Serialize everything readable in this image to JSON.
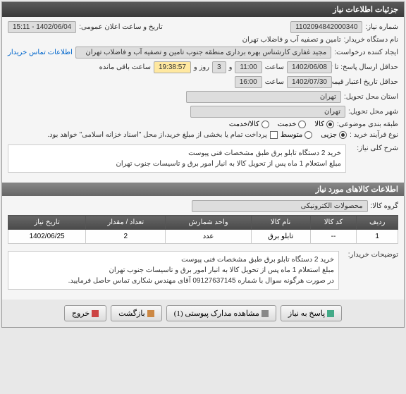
{
  "header": {
    "title": "جزئیات اطلاعات نیاز"
  },
  "fields": {
    "need_number_label": "شماره نیاز:",
    "need_number": "1102094842000340",
    "announce_label": "تاریخ و ساعت اعلان عمومی:",
    "announce_value": "1402/06/04 - 15:11",
    "buyer_org_label": "نام دستگاه خریدار:",
    "buyer_org": "تامین و تصفیه آب و فاضلاب تهران",
    "creator_label": "ایجاد کننده درخواست:",
    "creator": "مجید غفاری کارشناس بهره برداری منطقه جنوب تامین و تصفیه آب و فاضلاب تهران",
    "contact_link": "اطلاعات تماس خریدار",
    "deadline_label": "حداقل ارسال پاسخ: تا تاریخ:",
    "deadline_date": "1402/06/08",
    "time_label": "ساعت",
    "deadline_time": "11:00",
    "and_label": "و",
    "days_value": "3",
    "days_label": "روز و",
    "countdown": "19:38:57",
    "remaining_label": "ساعت باقی مانده",
    "validity_label": "حداقل تاریخ اعتبار قیمت: تا تاریخ:",
    "validity_date": "1402/07/30",
    "validity_time": "16:00",
    "delivery_province_label": "استان محل تحویل:",
    "delivery_province": "تهران",
    "delivery_city_label": "شهر محل تحویل:",
    "delivery_city": "تهران",
    "category_label": "طبقه بندی موضوعی:",
    "cat_goods": "کالا",
    "cat_service": "خدمت",
    "cat_both": "کالا/خدمت",
    "process_label": "نوع فرآیند خرید :",
    "proc_minor": "جزیی",
    "proc_medium": "متوسط",
    "payment_note": "پرداخت تمام یا بخشی از مبلغ خرید،از محل \"اسناد خزانه اسلامی\" خواهد بود.",
    "overview_label": "شرح کلی نیاز:",
    "overview_line1": "خرید 2 دستگاه تابلو برق طبق مشخصات فنی پیوست",
    "overview_line2": "مبلغ استعلام 1 ماه پس از تحویل کالا به انبار امور برق و تاسیسات جنوب تهران",
    "items_header": "اطلاعات کالاهای مورد نیاز",
    "group_label": "گروه کالا:",
    "group_value": "محصولات الکترونیکی",
    "buyer_notes_label": "توضیحات خریدار:",
    "buyer_notes_line1": "خرید 2 دستگاه تابلو برق طبق مشخصات فنی پیوست",
    "buyer_notes_line2": "مبلغ استعلام 1 ماه پس از تحویل کالا به انبار امور برق و تاسیسات جنوب تهران",
    "buyer_notes_line3": "در صورت هرگونه سوال با شماره 09127637145 آقای مهندس شکاری تماس حاصل فرمایید."
  },
  "table": {
    "headers": {
      "row": "ردیف",
      "code": "کد کالا",
      "name": "نام کالا",
      "unit": "واحد شمارش",
      "qty": "تعداد / مقدار",
      "date": "تاریخ نیاز"
    },
    "rows": [
      {
        "row": "1",
        "code": "--",
        "name": "تابلو برق",
        "unit": "عدد",
        "qty": "2",
        "date": "1402/06/25"
      }
    ]
  },
  "buttons": {
    "respond": "پاسخ به نیاز",
    "attachments": "مشاهده مدارک پیوستی (1)",
    "back": "بازگشت",
    "exit": "خروج"
  }
}
